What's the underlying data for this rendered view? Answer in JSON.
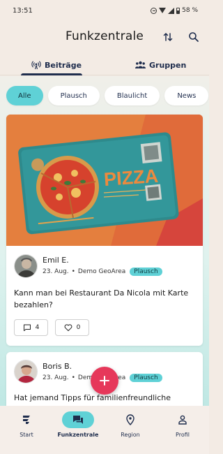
{
  "status_bar": {
    "time": "13:51",
    "battery": "58 %"
  },
  "app_bar": {
    "title": "Funkzentrale"
  },
  "tabs": [
    {
      "label": "Beiträge",
      "selected": true
    },
    {
      "label": "Gruppen",
      "selected": false
    }
  ],
  "filters": [
    {
      "label": "Alle",
      "selected": true
    },
    {
      "label": "Plausch",
      "selected": false
    },
    {
      "label": "Blaulicht",
      "selected": false
    },
    {
      "label": "News",
      "selected": false
    }
  ],
  "posts": [
    {
      "image_text": "PIZZA",
      "author": "Emil E.",
      "date": "23. Aug.",
      "separator": "•",
      "area": "Demo GeoArea",
      "tag": "Plausch",
      "text": "Kann man bei Restaurant Da Nicola mit Karte bezahlen?",
      "comments": "4",
      "likes": "0"
    },
    {
      "author": "Boris B.",
      "date": "23. Aug.",
      "separator": "•",
      "area": "Demo GeoArea",
      "tag": "Plausch",
      "text": "Hat jemand Tipps für familienfreundliche"
    }
  ],
  "bottom_nav": [
    {
      "label": "Start",
      "icon": "start-logo-icon",
      "selected": false
    },
    {
      "label": "Funkzentrale",
      "icon": "chat-icon",
      "selected": true
    },
    {
      "label": "Region",
      "icon": "location-pin-icon",
      "selected": false
    },
    {
      "label": "Profil",
      "icon": "person-icon",
      "selected": false
    }
  ],
  "colors": {
    "accent": "#5fd1d6",
    "fab": "#e6385a",
    "navy": "#1f2d4d"
  }
}
